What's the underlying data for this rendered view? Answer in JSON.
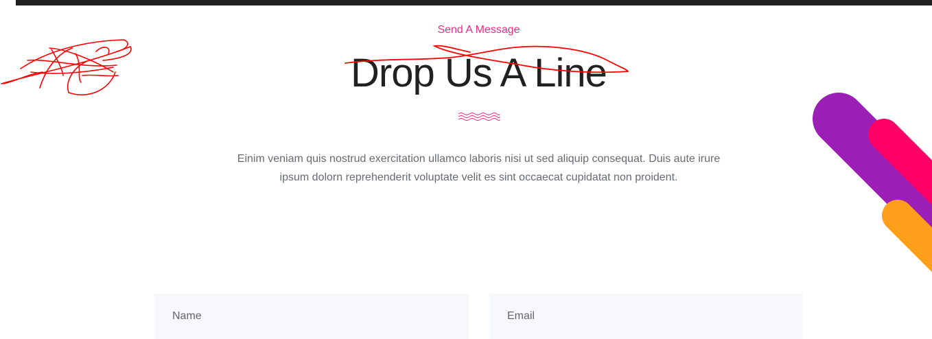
{
  "section": {
    "subtitle": "Send A Message",
    "heading": "Drop Us A Line",
    "description_line1": "Einim veniam quis nostrud exercitation ullamco laboris nisi ut sed aliquip consequat. Duis aute irure",
    "description_line2": "ipsum dolorn reprehenderit voluptate velit es sint occaecat cupidatat non proident."
  },
  "form": {
    "name_placeholder": "Name",
    "email_placeholder": "Email"
  },
  "colors": {
    "accent": "#ea2a83",
    "heading": "#212121",
    "body_text": "#666a73",
    "field_bg": "#f6f8fb",
    "decor_purple": "#9c1fb5",
    "decor_pink": "#ff0066",
    "decor_orange": "#ff9f1c",
    "annotation_red": "#ff0000"
  },
  "icons": {
    "divider": "wave-divider-icon"
  }
}
